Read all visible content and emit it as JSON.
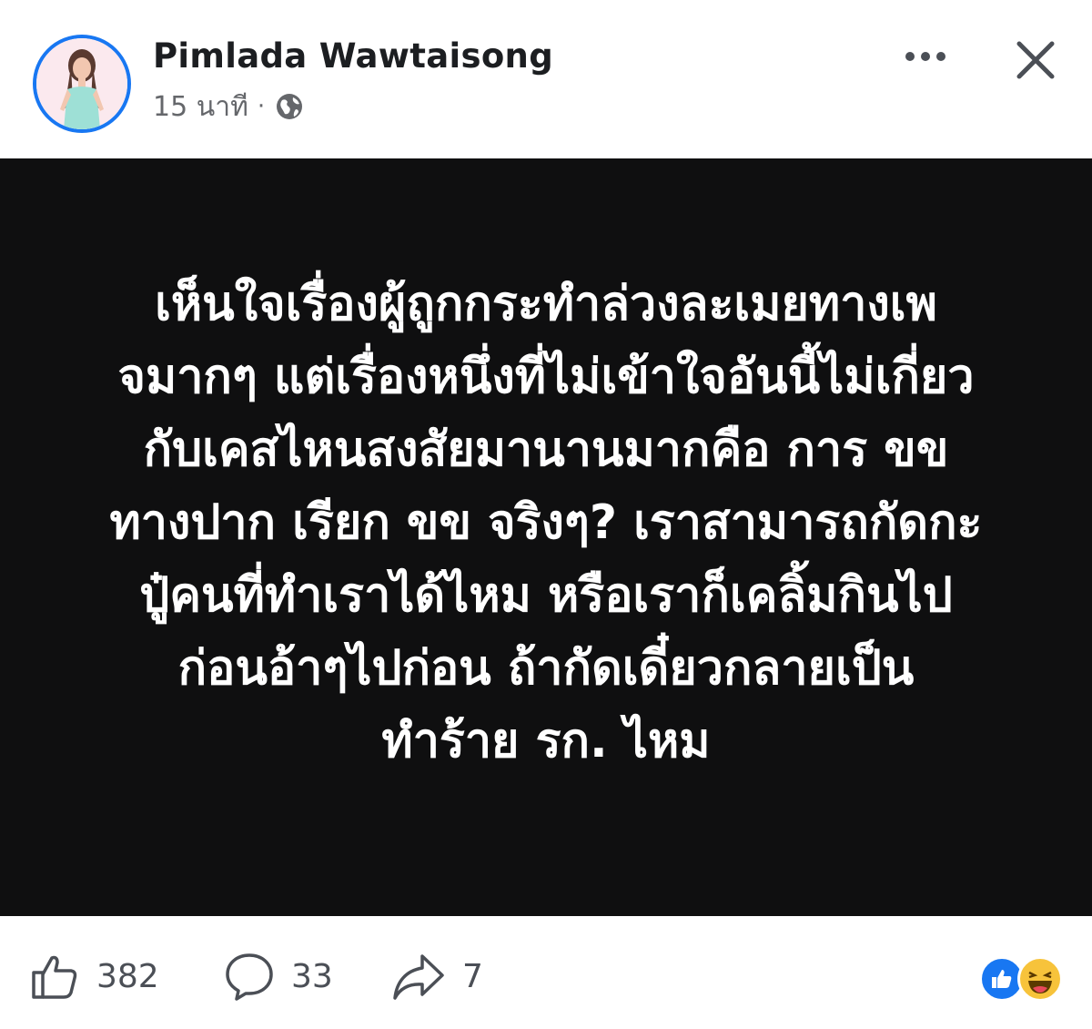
{
  "post": {
    "author": "Pimlada Wawtaisong",
    "time": "15 นาที",
    "separator": "·",
    "privacy_icon": "globe-icon",
    "body_lines": [
      "เห็นใจเรื่องผู้ถูกกระทำล่วงละเมยทางเพ",
      "จมากๆ แต่เรื่องหนึ่งที่ไม่เข้าใจอันนี้ไม่เกี่ยว",
      "กับเคสไหนสงสัยมานานมากคือ การ ขข",
      "ทางปาก เรียก ขข จริงๆ? เราสามารถกัดกะ",
      "ปู๋คนที่ทำเราได้ไหม หรือเราก็เคลิ้มกินไป",
      "ก่อนอ้าๆไปก่อน ถ้ากัดเดี๋ยวกลายเป็น",
      "ทำร้าย รก. ไหม"
    ],
    "background_color": "#0f0f10",
    "text_color": "#ffffff"
  },
  "actions": {
    "likes": "382",
    "comments": "33",
    "shares": "7"
  },
  "reactions": [
    "like",
    "haha"
  ],
  "colors": {
    "accent": "#1877f2",
    "name": "#1c1e21",
    "meta": "#65676b"
  }
}
